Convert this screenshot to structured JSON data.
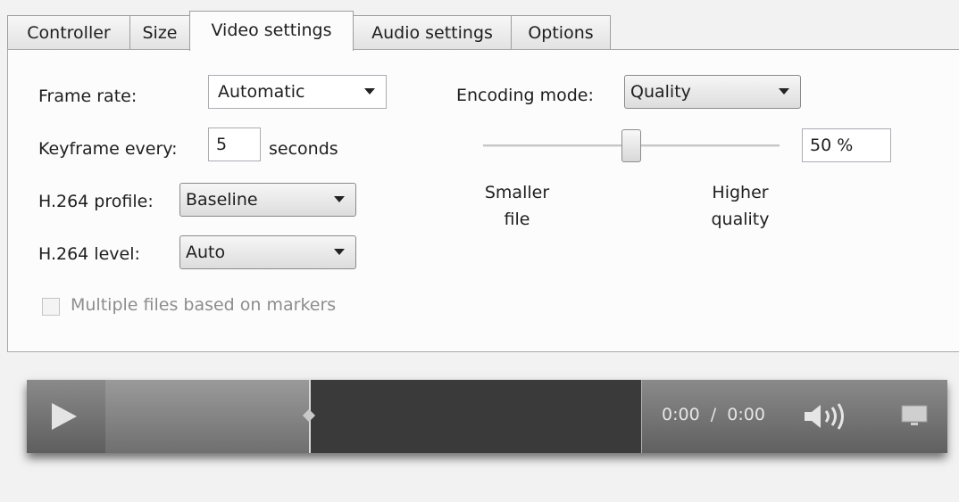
{
  "tabs": [
    "Controller",
    "Size",
    "Video settings",
    "Audio settings",
    "Options"
  ],
  "active_tab": "Video settings",
  "video": {
    "frame_rate_label": "Frame rate:",
    "frame_rate_value": "Automatic",
    "keyframe_label": "Keyframe every:",
    "keyframe_value": "5",
    "keyframe_unit": "seconds",
    "profile_label": "H.264 profile:",
    "profile_value": "Baseline",
    "level_label": "H.264 level:",
    "level_value": "Auto",
    "multiple_files_label": "Multiple files based on markers",
    "multiple_files_checked": false,
    "encoding_mode_label": "Encoding mode:",
    "encoding_mode_value": "Quality",
    "quality_percent": 50,
    "quality_text": "50 %",
    "slider_left_label_1": "Smaller",
    "slider_left_label_2": "file",
    "slider_right_label_1": "Higher",
    "slider_right_label_2": "quality"
  },
  "player": {
    "time_current": "0:00",
    "time_separator": "/",
    "time_total": "0:00",
    "progress_fraction": 0.38,
    "icons": [
      "play-icon",
      "volume-icon",
      "fullscreen-icon"
    ]
  }
}
